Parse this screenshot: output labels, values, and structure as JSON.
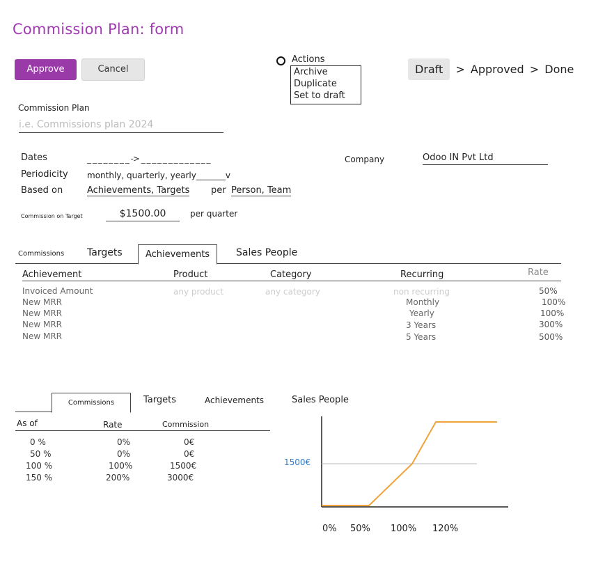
{
  "title": "Commission Plan: form",
  "toolbar": {
    "approve_label": "Approve",
    "cancel_label": "Cancel"
  },
  "actions": {
    "label": "Actions",
    "items": [
      "Archive",
      "Duplicate",
      "Set to draft"
    ]
  },
  "status": {
    "steps": [
      "Draft",
      "Approved",
      "Done"
    ],
    "active": "Draft"
  },
  "form": {
    "name_label": "Commission Plan",
    "name_placeholder": "i.e. Commissions plan 2024",
    "dates_label": "Dates",
    "dates_value": "_ _ _ _ _ _ _ _ ->  _ _ _ _ _ _ _ _ _ _ _ _ _",
    "periodicity_label": "Periodicity",
    "periodicity_value": "monthly, quarterly, yearly_______v",
    "based_on_label": "Based on",
    "based_on_value": "Achievements, Targets",
    "per_label": "per",
    "per_value": "Person, Team",
    "company_label": "Company",
    "company_value": "Odoo IN Pvt Ltd",
    "commission_target_label": "Commission on Target",
    "commission_target_value": "$1500.00",
    "commission_target_period": "per quarter"
  },
  "tabs_top": [
    {
      "label": "Commissions",
      "active": false
    },
    {
      "label": "Targets",
      "active": false
    },
    {
      "label": "Achievements",
      "active": true
    },
    {
      "label": "Sales People",
      "active": false
    }
  ],
  "achievements_table": {
    "columns": [
      "Achievement",
      "Product",
      "Category",
      "Recurring",
      "Rate"
    ],
    "rows": [
      [
        "Invoiced Amount",
        "any product",
        "any category",
        "non recurring",
        "50%"
      ],
      [
        "New MRR",
        "",
        "",
        "Monthly",
        "100%"
      ],
      [
        "New MRR",
        "",
        "",
        "Yearly",
        "100%"
      ],
      [
        "New MRR",
        "",
        "",
        "3 Years",
        "300%"
      ],
      [
        "New MRR",
        "",
        "",
        "5 Years",
        "500%"
      ]
    ]
  },
  "tabs_bottom": [
    {
      "label": "Commissions",
      "active": true
    },
    {
      "label": "Targets",
      "active": false
    },
    {
      "label": "Achievements",
      "active": false
    },
    {
      "label": "Sales People",
      "active": false
    }
  ],
  "commission_table": {
    "columns": [
      "As of",
      "Rate",
      "Commission"
    ],
    "rows": [
      [
        "0 %",
        "0%",
        "0€"
      ],
      [
        "50 %",
        "0%",
        "0€"
      ],
      [
        "100 %",
        "100%",
        "1500€"
      ],
      [
        "150 %",
        "200%",
        "3000€"
      ]
    ]
  },
  "chart_data": {
    "type": "line",
    "x": [
      0,
      50,
      100,
      120,
      150
    ],
    "y": [
      0,
      0,
      1500,
      3000,
      3000
    ],
    "xticks": [
      "0%",
      "50%",
      "100%",
      "120%"
    ],
    "reference_label": "1500€",
    "reference_value": 1500,
    "line_color": "#f0a33a",
    "reference_label_color": "#2f7ac4"
  }
}
